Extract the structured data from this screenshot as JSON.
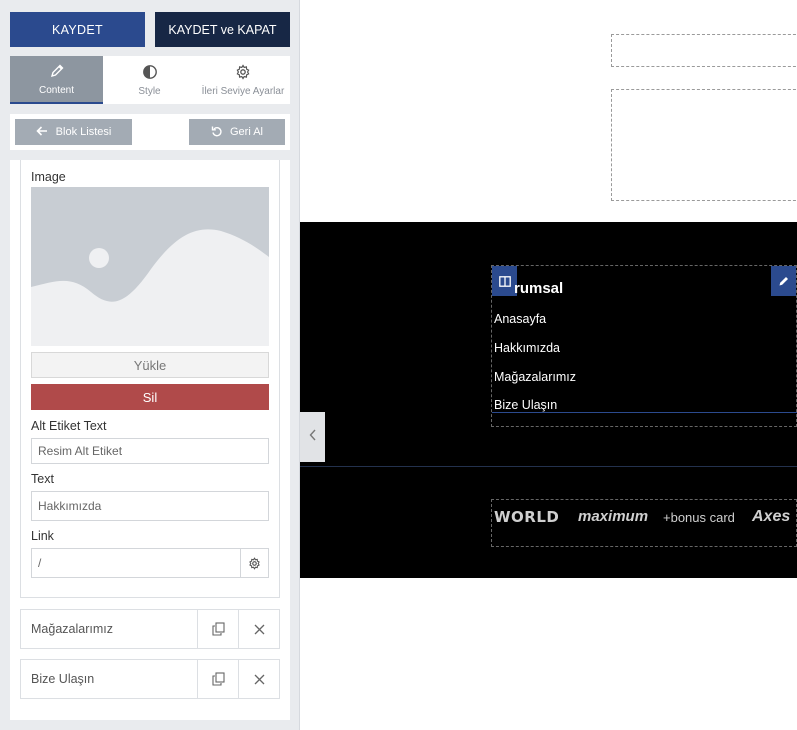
{
  "toolbar": {
    "save_label": "KAYDET",
    "save_close_label": "KAYDET ve KAPAT"
  },
  "tabs": [
    {
      "label": "Content",
      "icon": "pencil-icon",
      "active": true
    },
    {
      "label": "Style",
      "icon": "contrast-icon",
      "active": false
    },
    {
      "label": "İleri Seviye Ayarlar",
      "icon": "gear-icon",
      "active": false
    }
  ],
  "nav": {
    "back_label": "Blok Listesi",
    "undo_label": "Geri Al"
  },
  "form": {
    "image_label": "Image",
    "upload_label": "Yükle",
    "delete_label": "Sil",
    "alt_label": "Alt Etiket Text",
    "alt_placeholder": "Resim Alt Etiket",
    "text_label": "Text",
    "text_value": "Hakkımızda",
    "link_label": "Link",
    "link_value": "/"
  },
  "items": [
    {
      "label": "Mağazalarımız"
    },
    {
      "label": "Bize Ulaşın"
    }
  ],
  "preview": {
    "menu_title": "rumsal",
    "menu_links": [
      "Anasayfa",
      "Hakkımızda",
      "Mağazalarımız",
      "Bize Ulaşın"
    ],
    "logos": [
      "WORLD",
      "maximum",
      "+bonus card",
      "Axes"
    ]
  },
  "colors": {
    "primary": "#2b4a8e",
    "dark": "#172745",
    "danger": "#b04a4a",
    "muted": "#a3abb4"
  }
}
